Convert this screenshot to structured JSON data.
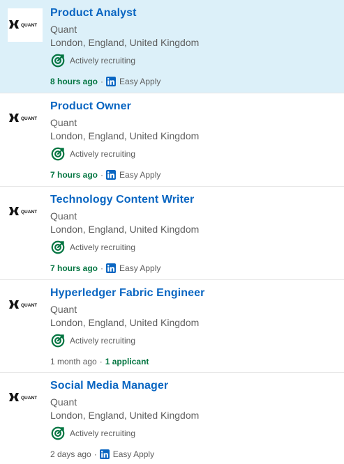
{
  "jobs": [
    {
      "title": "Product Analyst",
      "company": "Quant",
      "location": "London, England, United Kingdom",
      "status": "Actively recruiting",
      "posted": "8 hours ago",
      "separator": "·",
      "apply": "Easy Apply",
      "applicants": null,
      "posted_new": true,
      "selected": true
    },
    {
      "title": "Product Owner",
      "company": "Quant",
      "location": "London, England, United Kingdom",
      "status": "Actively recruiting",
      "posted": "7 hours ago",
      "separator": "·",
      "apply": "Easy Apply",
      "applicants": null,
      "posted_new": true,
      "selected": false
    },
    {
      "title": "Technology Content Writer",
      "company": "Quant",
      "location": "London, England, United Kingdom",
      "status": "Actively recruiting",
      "posted": "7 hours ago",
      "separator": "·",
      "apply": "Easy Apply",
      "applicants": null,
      "posted_new": true,
      "selected": false
    },
    {
      "title": "Hyperledger Fabric Engineer",
      "company": "Quant",
      "location": "London, England, United Kingdom",
      "status": "Actively recruiting",
      "posted": "1 month ago",
      "separator": "·",
      "apply": null,
      "applicants": "1 applicant",
      "posted_new": false,
      "selected": false
    },
    {
      "title": "Social Media Manager",
      "company": "Quant",
      "location": "London, England, United Kingdom",
      "status": "Actively recruiting",
      "posted": "2 days ago",
      "separator": "·",
      "apply": "Easy Apply",
      "applicants": null,
      "posted_new": false,
      "selected": false
    }
  ],
  "logo_text": "QUANT",
  "icons": {
    "company_logo": "quant-logo",
    "recruiting": "target-check-icon",
    "easy_apply": "linkedin-icon"
  },
  "colors": {
    "link": "#0a66c2",
    "success": "#057642",
    "selected_bg": "#dcf0f9",
    "muted": "#5e5e5e"
  }
}
